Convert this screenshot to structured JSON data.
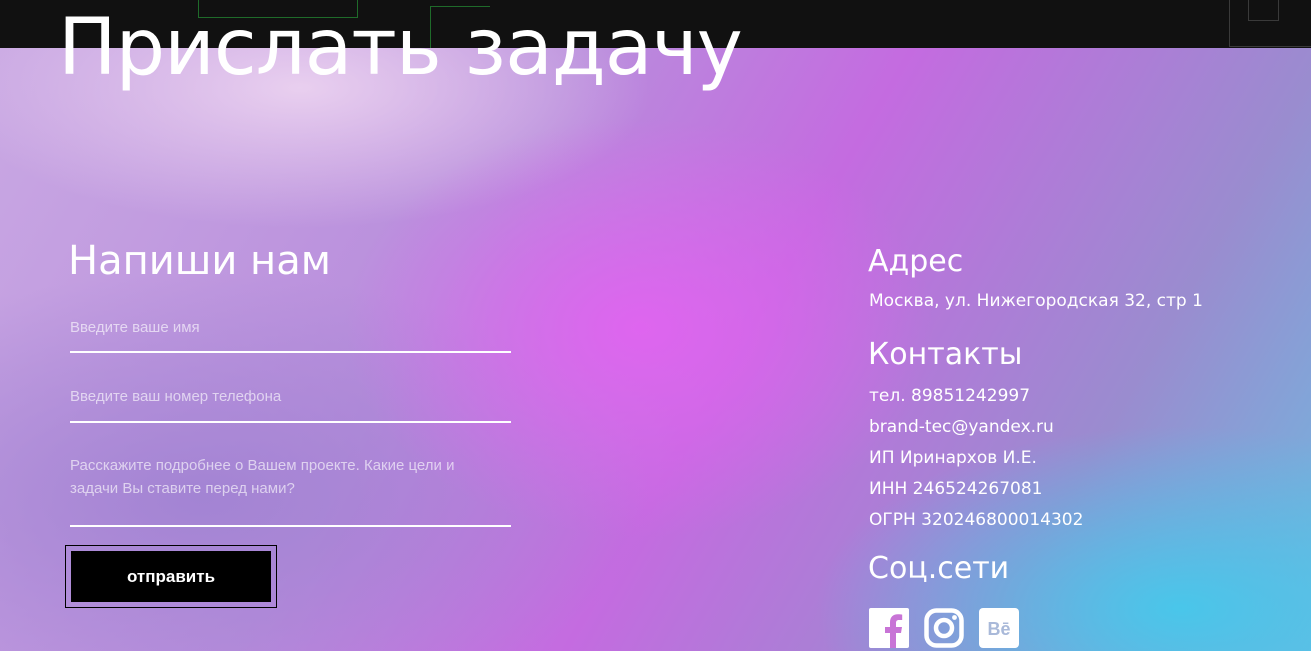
{
  "page": {
    "title": "Прислать задачу"
  },
  "form": {
    "heading": "Напиши нам",
    "name_placeholder": "Введите ваше имя",
    "phone_placeholder": "Введите ваш номер телефона",
    "project_placeholder": "Расскажите подробнее о Вашем проекте. Какие цели и задачи Вы ставите перед нами?",
    "submit_label": "отправить"
  },
  "address": {
    "heading": "Адрес",
    "value": "Москва, ул. Нижегородская 32, стр 1"
  },
  "contacts": {
    "heading": "Контакты",
    "phone": "тел. 89851242997",
    "email": "brand-tec@yandex.ru",
    "company": "ИП Иринархов И.Е.",
    "inn": "ИНН 246524267081",
    "ogrn": "ОГРН 320246800014302"
  },
  "socials": {
    "heading": "Соц.сети",
    "items": [
      {
        "icon": "facebook-icon"
      },
      {
        "icon": "instagram-icon"
      },
      {
        "icon": "behance-icon"
      }
    ]
  },
  "colors": {
    "top_bar": "#111111",
    "button_bg": "#000000",
    "accent_pink": "#d964ec",
    "accent_cyan": "#46c8eb"
  }
}
